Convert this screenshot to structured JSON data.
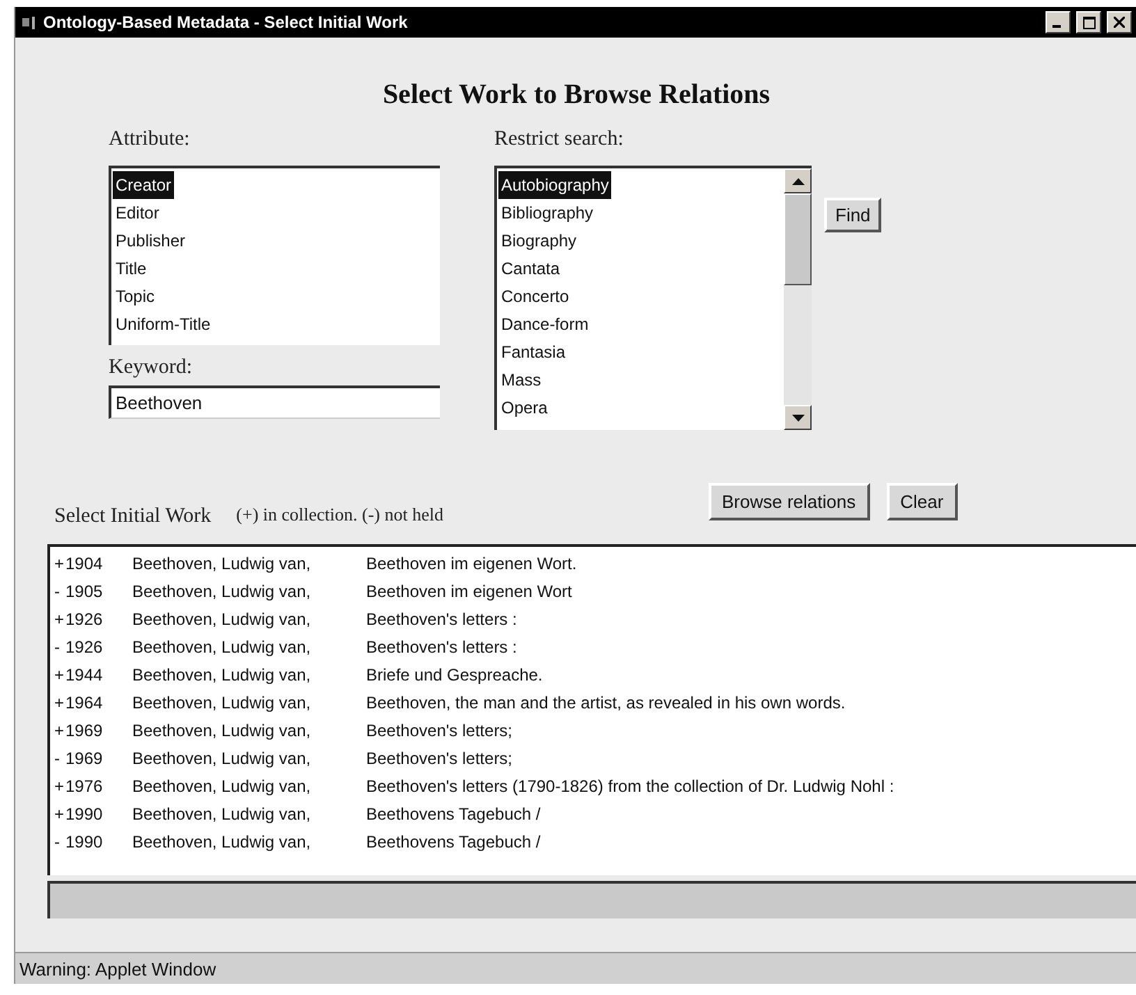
{
  "window": {
    "title": "Ontology-Based Metadata - Select Initial Work"
  },
  "heading": "Select Work to Browse Relations",
  "attribute": {
    "label": "Attribute:",
    "items": [
      {
        "label": "Creator",
        "selected": true
      },
      {
        "label": "Editor",
        "selected": false
      },
      {
        "label": "Publisher",
        "selected": false
      },
      {
        "label": "Title",
        "selected": false
      },
      {
        "label": "Topic",
        "selected": false
      },
      {
        "label": "Uniform-Title",
        "selected": false
      }
    ]
  },
  "keyword": {
    "label": "Keyword:",
    "value": "Beethoven"
  },
  "restrict": {
    "label": "Restrict search:",
    "items": [
      {
        "label": "Autobiography",
        "selected": true
      },
      {
        "label": "Bibliography",
        "selected": false
      },
      {
        "label": "Biography",
        "selected": false
      },
      {
        "label": "Cantata",
        "selected": false
      },
      {
        "label": "Concerto",
        "selected": false
      },
      {
        "label": "Dance-form",
        "selected": false
      },
      {
        "label": "Fantasia",
        "selected": false
      },
      {
        "label": "Mass",
        "selected": false
      },
      {
        "label": "Opera",
        "selected": false
      }
    ]
  },
  "find_button": "Find",
  "results": {
    "label": "Select Initial Work",
    "legend": "(+) in collection. (-) not held",
    "buttons": [
      "Browse relations",
      "Clear"
    ],
    "rows": [
      {
        "marker": "+",
        "year": "1904",
        "creator": "Beethoven, Ludwig van,",
        "title": "Beethoven im eigenen Wort."
      },
      {
        "marker": "-",
        "year": "1905",
        "creator": "Beethoven, Ludwig van,",
        "title": "Beethoven im eigenen Wort"
      },
      {
        "marker": "+",
        "year": "1926",
        "creator": "Beethoven, Ludwig van,",
        "title": "Beethoven's letters :"
      },
      {
        "marker": "-",
        "year": "1926",
        "creator": "Beethoven, Ludwig van,",
        "title": "Beethoven's letters :"
      },
      {
        "marker": "+",
        "year": "1944",
        "creator": "Beethoven, Ludwig van,",
        "title": "Briefe und Gespreache."
      },
      {
        "marker": "+",
        "year": "1964",
        "creator": "Beethoven, Ludwig van,",
        "title": "Beethoven, the man and the artist, as revealed in his own words."
      },
      {
        "marker": "+",
        "year": "1969",
        "creator": "Beethoven, Ludwig van,",
        "title": "Beethoven's letters;"
      },
      {
        "marker": "-",
        "year": "1969",
        "creator": "Beethoven, Ludwig van,",
        "title": "Beethoven's letters;"
      },
      {
        "marker": "+",
        "year": "1976",
        "creator": "Beethoven, Ludwig van,",
        "title": "Beethoven's letters (1790-1826) from the collection of Dr. Ludwig Nohl :"
      },
      {
        "marker": "+",
        "year": "1990",
        "creator": "Beethoven, Ludwig van,",
        "title": "Beethovens Tagebuch /"
      },
      {
        "marker": "-",
        "year": "1990",
        "creator": "Beethoven, Ludwig van,",
        "title": "Beethovens Tagebuch /"
      }
    ]
  },
  "status_bar": "Warning: Applet Window"
}
